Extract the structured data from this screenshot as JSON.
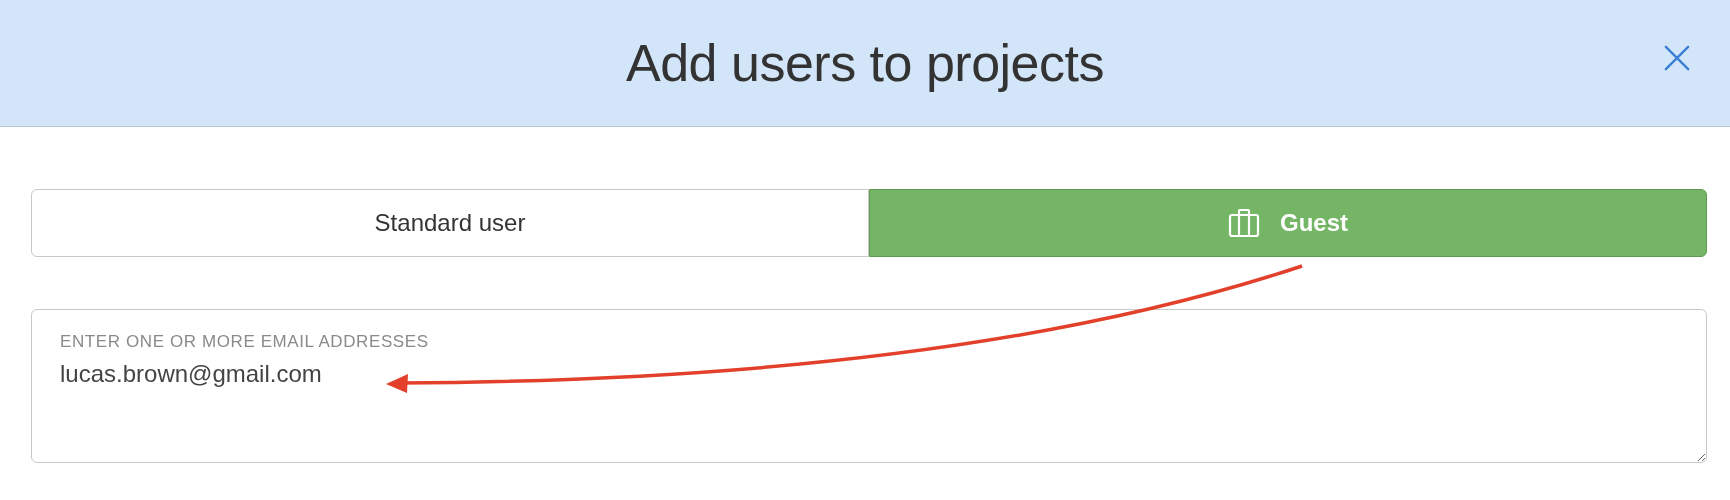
{
  "dialog": {
    "title": "Add users to projects"
  },
  "user_types": [
    {
      "label": "Standard user",
      "selected": false,
      "icon": false
    },
    {
      "label": "Guest",
      "selected": true,
      "icon": true
    }
  ],
  "email_field": {
    "label": "ENTER ONE OR MORE EMAIL ADDRESSES",
    "value": "lucas.brown@gmail.com"
  }
}
